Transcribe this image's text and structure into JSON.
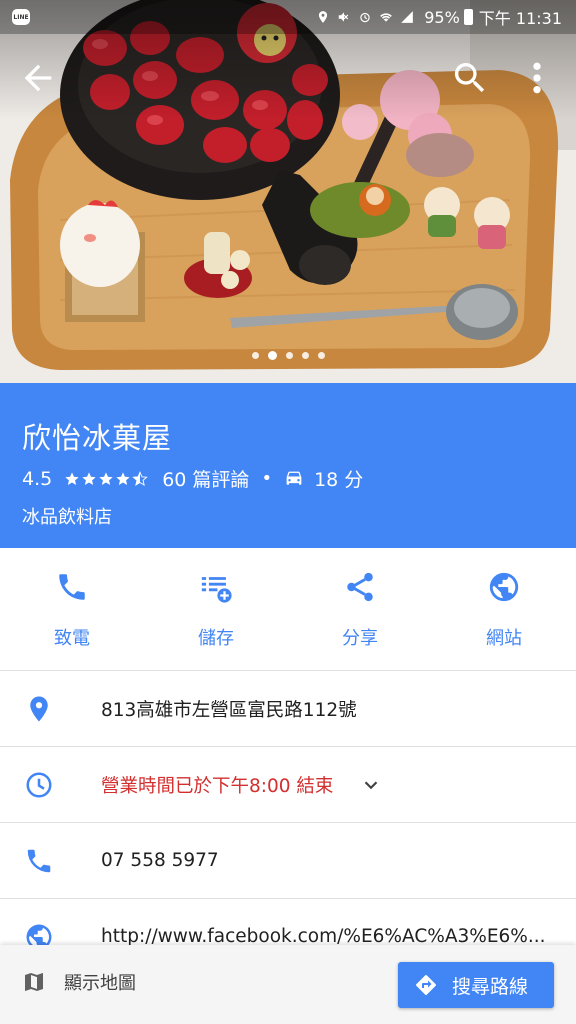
{
  "status_bar": {
    "app_icon": "LINE",
    "battery": "95%",
    "time": "下午 11:31"
  },
  "photo": {
    "subject": "strawberry shaved ice dessert on wooden tray",
    "page_count": 5,
    "current_page": 2
  },
  "app_bar": {
    "back_icon": "arrow-back-icon",
    "search_icon": "search-icon",
    "more_icon": "more-vert-icon"
  },
  "place": {
    "name": "欣怡冰菓屋",
    "rating": "4.5",
    "stars": 4.5,
    "reviews": "60 篇評論",
    "separator": "•",
    "drive_time": "18 分",
    "category": "冰品飲料店"
  },
  "actions": [
    {
      "label": "致電",
      "icon": "phone-icon"
    },
    {
      "label": "儲存",
      "icon": "save-list-icon"
    },
    {
      "label": "分享",
      "icon": "share-icon"
    },
    {
      "label": "網站",
      "icon": "globe-icon"
    }
  ],
  "info": {
    "address": "813高雄市左營區富民路112號",
    "hours": "營業時間已於下午8:00 結束",
    "phone": "07 558 5977",
    "website": "http://www.facebook.com/%E6%AC%A3%E6%..."
  },
  "bottom_bar": {
    "show_map": "顯示地圖",
    "directions": "搜尋路線"
  },
  "colors": {
    "accent": "#4285f4",
    "closed_text": "#d32f2f"
  }
}
